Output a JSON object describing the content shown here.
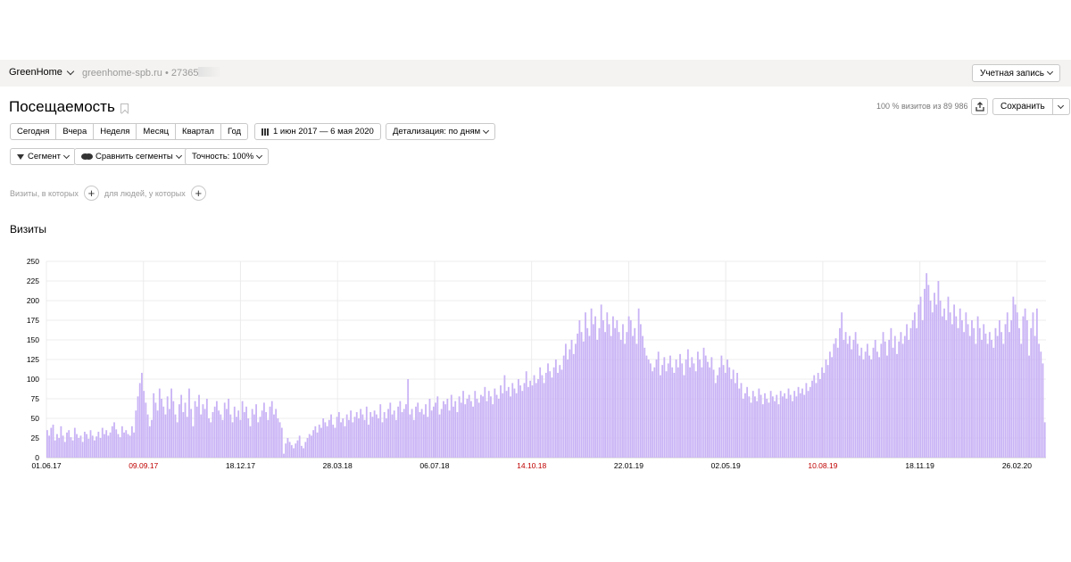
{
  "topbar": {
    "counter_name": "GreenHome",
    "site": "greenhome-spb.ru • 27365",
    "account_label": "Учетная запись"
  },
  "header": {
    "title": "Посещаемость",
    "visits_share": "100 % визитов из 89 986",
    "save_label": "Сохранить"
  },
  "toolbar": {
    "periods": [
      "Сегодня",
      "Вчера",
      "Неделя",
      "Месяц",
      "Квартал",
      "Год"
    ],
    "date_range": "1 июн 2017 — 6 мая 2020",
    "detail": "Детализация: по дням",
    "segment": "Сегмент",
    "compare": "Сравнить сегменты",
    "accuracy": "Точность: 100%"
  },
  "segment_builder": {
    "visits_label": "Визиты, в которых",
    "people_label": "для людей, у которых"
  },
  "chart_data": {
    "type": "bar",
    "title": "Визиты",
    "color": "#c9b3f5",
    "ylim": [
      0,
      250
    ],
    "yticks": [
      0,
      25,
      50,
      75,
      100,
      125,
      150,
      175,
      200,
      225,
      250
    ],
    "xticks": [
      {
        "label": "01.06.17",
        "weekend": false
      },
      {
        "label": "09.09.17",
        "weekend": true
      },
      {
        "label": "18.12.17",
        "weekend": false
      },
      {
        "label": "28.03.18",
        "weekend": false
      },
      {
        "label": "06.07.18",
        "weekend": false
      },
      {
        "label": "14.10.18",
        "weekend": true
      },
      {
        "label": "22.01.19",
        "weekend": false
      },
      {
        "label": "02.05.19",
        "weekend": false
      },
      {
        "label": "10.08.19",
        "weekend": true
      },
      {
        "label": "18.11.19",
        "weekend": false
      },
      {
        "label": "26.02.20",
        "weekend": false
      }
    ],
    "xtick_color": "#000000",
    "weekend_tick_color": "#c00000",
    "grid": true,
    "series": [
      {
        "values": [
          35,
          28,
          38,
          42,
          22,
          30,
          25,
          40,
          28,
          20,
          32,
          35,
          26,
          22,
          38,
          30,
          25,
          28,
          20,
          33,
          30,
          24,
          35,
          28,
          22,
          27,
          33,
          25,
          38,
          30,
          35,
          28,
          32,
          40,
          45,
          36,
          30,
          26,
          40,
          32,
          35,
          30,
          28,
          40,
          32,
          60,
          78,
          95,
          108,
          85,
          70,
          55,
          40,
          48,
          82,
          70,
          60,
          88,
          75,
          65,
          55,
          78,
          62,
          88,
          72,
          55,
          45,
          68,
          80,
          58,
          70,
          52,
          88,
          62,
          40,
          72,
          65,
          80,
          55,
          68,
          62,
          75,
          50,
          45,
          58,
          65,
          72,
          60,
          55,
          48,
          70,
          62,
          75,
          55,
          45,
          65,
          52,
          60,
          48,
          72,
          58,
          65,
          50,
          40,
          62,
          55,
          68,
          45,
          52,
          60,
          70,
          58,
          48,
          65,
          72,
          55,
          62,
          50,
          45,
          38,
          5,
          18,
          25,
          20,
          16,
          12,
          18,
          22,
          28,
          15,
          12,
          20,
          25,
          30,
          28,
          35,
          40,
          32,
          42,
          38,
          50,
          45,
          40,
          48,
          55,
          42,
          38,
          52,
          58,
          45,
          50,
          40,
          55,
          48,
          60,
          45,
          52,
          58,
          50,
          62,
          55,
          48,
          65,
          42,
          58,
          52,
          60,
          55,
          50,
          68,
          45,
          58,
          50,
          62,
          70,
          55,
          60,
          48,
          65,
          72,
          58,
          62,
          68,
          100,
          55,
          62,
          48,
          65,
          70,
          58,
          62,
          55,
          68,
          52,
          75,
          60,
          65,
          70,
          78,
          55,
          62,
          72,
          68,
          75,
          60,
          80,
          65,
          72,
          58,
          78,
          70,
          85,
          68,
          75,
          80,
          72,
          65,
          85,
          75,
          70,
          80,
          78,
          90,
          72,
          85,
          78,
          68,
          88,
          80,
          75,
          92,
          82,
          105,
          85,
          90,
          78,
          95,
          88,
          82,
          100,
          92,
          85,
          95,
          110,
          90,
          98,
          92,
          105,
          95,
          100,
          115,
          105,
          95,
          108,
          120,
          110,
          102,
          115,
          125,
          108,
          118,
          112,
          130,
          145,
          125,
          138,
          150,
          132,
          145,
          158,
          175,
          160,
          148,
          185,
          165,
          155,
          190,
          170,
          180,
          150,
          165,
          195,
          175,
          160,
          185,
          170,
          155,
          180,
          165,
          175,
          160,
          150,
          170,
          145,
          160,
          180,
          175,
          155,
          165,
          145,
          190,
          170,
          155,
          140,
          130,
          125,
          120,
          110,
          115,
          125,
          135,
          105,
          118,
          128,
          110,
          120,
          130,
          115,
          108,
          125,
          115,
          132,
          120,
          105,
          125,
          138,
          115,
          128,
          120,
          110,
          135,
          125,
          115,
          140,
          130,
          122,
          115,
          128,
          112,
          95,
          105,
          115,
          130,
          118,
          108,
          125,
          115,
          100,
          112,
          95,
          108,
          88,
          95,
          75,
          82,
          90,
          78,
          70,
          85,
          78,
          72,
          88,
          80,
          68,
          82,
          75,
          70,
          85,
          78,
          72,
          80,
          68,
          85,
          78,
          82,
          75,
          88,
          80,
          72,
          85,
          78,
          90,
          82,
          88,
          80,
          95,
          85,
          90,
          98,
          105,
          95,
          108,
          100,
          115,
          108,
          125,
          118,
          135,
          128,
          145,
          152,
          140,
          165,
          185,
          150,
          160,
          145,
          155,
          138,
          150,
          160,
          145,
          130,
          140,
          125,
          135,
          145,
          130,
          125,
          140,
          150,
          135,
          128,
          145,
          160,
          148,
          130,
          150,
          165,
          140,
          155,
          132,
          148,
          160,
          145,
          155,
          170,
          150,
          165,
          175,
          185,
          165,
          195,
          205,
          175,
          215,
          235,
          220,
          200,
          185,
          210,
          195,
          225,
          200,
          180,
          190,
          175,
          205,
          185,
          170,
          195,
          180,
          165,
          190,
          175,
          160,
          185,
          170,
          155,
          175,
          165,
          145,
          180,
          165,
          150,
          170,
          158,
          145,
          160,
          150,
          140,
          165,
          155,
          175,
          160,
          145,
          170,
          185,
          160,
          175,
          205,
          195,
          185,
          165,
          145,
          180,
          190,
          175,
          130,
          165,
          185,
          155,
          190,
          145,
          135,
          120,
          45
        ]
      }
    ]
  }
}
